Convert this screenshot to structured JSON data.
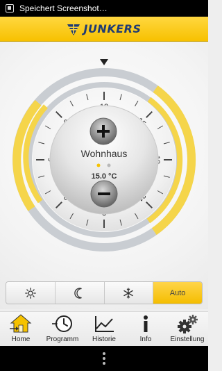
{
  "status_bar": {
    "notification": "Speichert Screenshot…"
  },
  "header": {
    "brand": "JUNKERS"
  },
  "dial": {
    "zone_name": "Wohnhaus",
    "temperature": "15.0 °C",
    "hour_labels": [
      "12",
      "15",
      "18",
      "21",
      "0",
      "3",
      "6",
      "9"
    ],
    "increase_icon": "plus-icon",
    "decrease_icon": "minus-icon",
    "colors": {
      "active": "#f5d54a",
      "inactive": "#c9cdd2",
      "accent": "#f6c200"
    }
  },
  "modes": {
    "items": [
      {
        "icon": "sun-icon",
        "label": ""
      },
      {
        "icon": "moon-icon",
        "label": ""
      },
      {
        "icon": "snowflake-icon",
        "label": ""
      },
      {
        "icon": "auto-icon",
        "label": "Auto"
      }
    ],
    "active_index": 3
  },
  "tabs": [
    {
      "label": "Home",
      "icon": "house-icon"
    },
    {
      "label": "Programm",
      "icon": "clock-icon"
    },
    {
      "label": "Historie",
      "icon": "graph-icon"
    },
    {
      "label": "Info",
      "icon": "info-icon"
    },
    {
      "label": "Einstellung",
      "icon": "gears-icon"
    }
  ]
}
